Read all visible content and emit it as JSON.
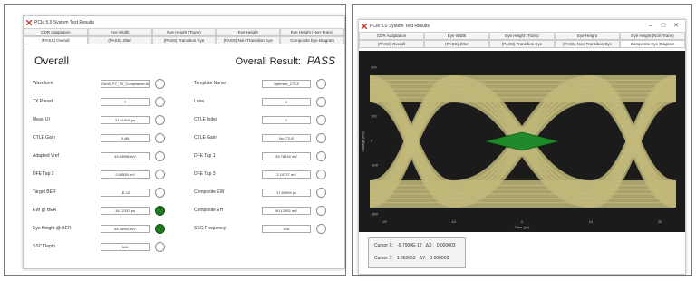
{
  "left_window": {
    "title": "PCIe 5.0 System Test Results",
    "tabs_upper": [
      "CDR Adaptation",
      "Eye Width",
      "Eye Height (Trans)",
      "Eye Height",
      "Eye Height (Non-Trans)"
    ],
    "tabs_lower": [
      "(PASS) Overall",
      "(PASS) Jitter",
      "(PASS) Transition Eye",
      "(PASS) Non-Transition Eye",
      "Composite Eye Diagram"
    ],
    "heading": "Overall",
    "overall_result_label": "Overall Result:",
    "overall_result_value": "PASS",
    "fields_left": [
      {
        "label": "Waveform",
        "value": "Gen5_P7_TX_Compliance.bin",
        "led": "off"
      },
      {
        "label": "TX Preset",
        "value": "7",
        "led": "off"
      },
      {
        "label": "Mean UI",
        "value": "31.01598 ps",
        "led": "off"
      },
      {
        "label": "CTLE Gain",
        "value": "0 dB",
        "led": "off"
      },
      {
        "label": "Adapted Vref",
        "value": "49.53986 mV",
        "led": "off"
      },
      {
        "label": "DFE Tap 2",
        "value": "2.68555 mV",
        "led": "off"
      },
      {
        "label": "Target BER",
        "value": "1E-12",
        "led": "off"
      },
      {
        "label": "EW @ BER",
        "value": "16.12157 ps",
        "led": "on"
      },
      {
        "label": "Eye Height @ BER",
        "value": "64.46982 mV",
        "led": "on"
      },
      {
        "label": "SSC Depth",
        "value": "N/A",
        "led": "off"
      }
    ],
    "fields_right": [
      {
        "label": "Template Name",
        "value": "Optimize_CTLE",
        "led": "off"
      },
      {
        "label": "Lane",
        "value": "0",
        "led": "off"
      },
      {
        "label": "CTLE Index",
        "value": "1",
        "led": "off"
      },
      {
        "label": "CTLE Gain",
        "value": "No CTLE",
        "led": "off"
      },
      {
        "label": "DFE Tap 1",
        "value": "39.78516 mV",
        "led": "off"
      },
      {
        "label": "DFE Tap 3",
        "value": "2.19727 mV",
        "led": "off"
      },
      {
        "label": "Composite EW",
        "value": "17.80599 ps",
        "led": "off"
      },
      {
        "label": "Composite EH",
        "value": "90.12892 mV",
        "led": "off"
      },
      {
        "label": "SSC Frequency",
        "value": "N/A",
        "led": "off"
      }
    ]
  },
  "right_window": {
    "title": "PCIe 5.0 System Test Results",
    "tabs_upper": [
      "CDR Adaptation",
      "Eye Width",
      "Eye Height (Trans)",
      "Eye Height",
      "Eye Height (Non-Trans)"
    ],
    "tabs_lower": [
      "(PASS) Overall",
      "(PASS) Jitter",
      "(PASS) Transition Eye",
      "(PASS) Non-Transition Eye",
      "Composite Eye Diagram"
    ],
    "cursor_x_label": "Cursor X:",
    "cursor_x_value": "-5.7900E-12",
    "cursor_dx_label": "ΔX:",
    "cursor_dx_value": "0.000003",
    "cursor_y_label": "Cursor Y:",
    "cursor_y_value": "1.063652",
    "cursor_dy_label": "ΔY:",
    "cursor_dy_value": "0.000003",
    "x_axis_label": "Time (ps)",
    "y_axis_label": "Voltage (mV)",
    "x_ticks": [
      "-20",
      "-10",
      "0",
      "10",
      "20"
    ],
    "y_ticks": [
      "300",
      "200",
      "100",
      "0",
      "-100",
      "-200",
      "-300"
    ],
    "colors": {
      "eye_trace": "#c2b97a",
      "eye_mask": "#1e8a2a",
      "plot_bg": "#1b1b1b"
    }
  }
}
